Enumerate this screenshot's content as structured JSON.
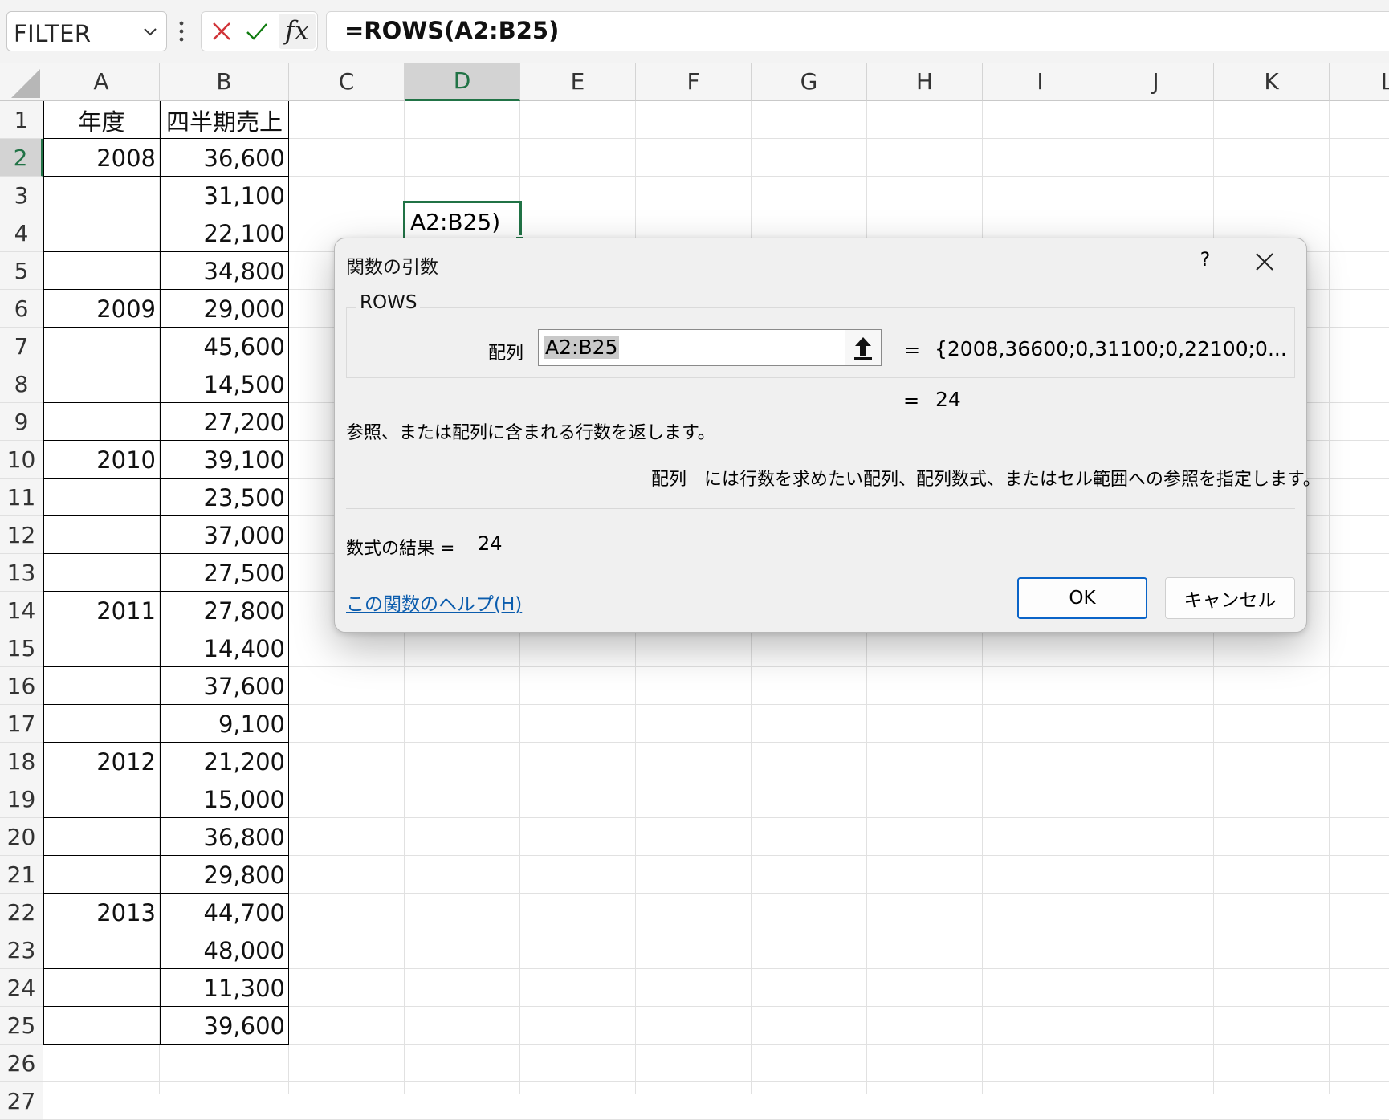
{
  "name_box": {
    "value": "FILTER"
  },
  "formula_bar": {
    "formula": "=ROWS(A2:B25)",
    "cancel_icon": "close-icon",
    "enter_icon": "check-icon",
    "fx_label": "fx"
  },
  "sheet": {
    "columns": [
      "A",
      "B",
      "C",
      "D",
      "E",
      "F",
      "G",
      "H",
      "I",
      "J",
      "K",
      "L"
    ],
    "selected_column": "D",
    "rows": [
      "1",
      "2",
      "3",
      "4",
      "5",
      "6",
      "7",
      "8",
      "9",
      "10",
      "11",
      "12",
      "13",
      "14",
      "15",
      "16",
      "17",
      "18",
      "19",
      "20",
      "21",
      "22",
      "23",
      "24",
      "25",
      "26",
      "27"
    ],
    "selected_row": "2",
    "header": {
      "a": "年度",
      "b": "四半期売上"
    },
    "data": [
      {
        "year": "2008",
        "sales": "36,600"
      },
      {
        "year": "",
        "sales": "31,100"
      },
      {
        "year": "",
        "sales": "22,100"
      },
      {
        "year": "",
        "sales": "34,800"
      },
      {
        "year": "2009",
        "sales": "29,000"
      },
      {
        "year": "",
        "sales": "45,600"
      },
      {
        "year": "",
        "sales": "14,500"
      },
      {
        "year": "",
        "sales": "27,200"
      },
      {
        "year": "2010",
        "sales": "39,100"
      },
      {
        "year": "",
        "sales": "23,500"
      },
      {
        "year": "",
        "sales": "37,000"
      },
      {
        "year": "",
        "sales": "27,500"
      },
      {
        "year": "2011",
        "sales": "27,800"
      },
      {
        "year": "",
        "sales": "14,400"
      },
      {
        "year": "",
        "sales": "37,600"
      },
      {
        "year": "",
        "sales": "9,100"
      },
      {
        "year": "2012",
        "sales": "21,200"
      },
      {
        "year": "",
        "sales": "15,000"
      },
      {
        "year": "",
        "sales": "36,800"
      },
      {
        "year": "",
        "sales": "29,800"
      },
      {
        "year": "2013",
        "sales": "44,700"
      },
      {
        "year": "",
        "sales": "48,000"
      },
      {
        "year": "",
        "sales": "11,300"
      },
      {
        "year": "",
        "sales": "39,600"
      }
    ],
    "active_cell_text": "A2:B25)"
  },
  "dialog": {
    "title": "関数の引数",
    "help_button": "?",
    "function_name": "ROWS",
    "arg_label": "配列",
    "arg_value": "A2:B25",
    "arg_equals": "=",
    "arg_evaluated": "{2008,36600;0,31100;0,22100;0...",
    "result_equals": "=",
    "result_preview": "24",
    "description": "参照、または配列に含まれる行数を返します。",
    "arg_desc_name": "配列",
    "arg_desc": "には行数を求めたい配列、配列数式、またはセル範囲への参照を指定します。",
    "formula_result_label": "数式の結果 =",
    "formula_result_value": "24",
    "help_link": "この関数のヘルプ(H)",
    "ok": "OK",
    "cancel": "キャンセル"
  },
  "colors": {
    "accent_green": "#217346",
    "cancel_red": "#d13438",
    "enter_green": "#107c10",
    "link_blue": "#0b5cad",
    "ok_border": "#0a64c8"
  }
}
